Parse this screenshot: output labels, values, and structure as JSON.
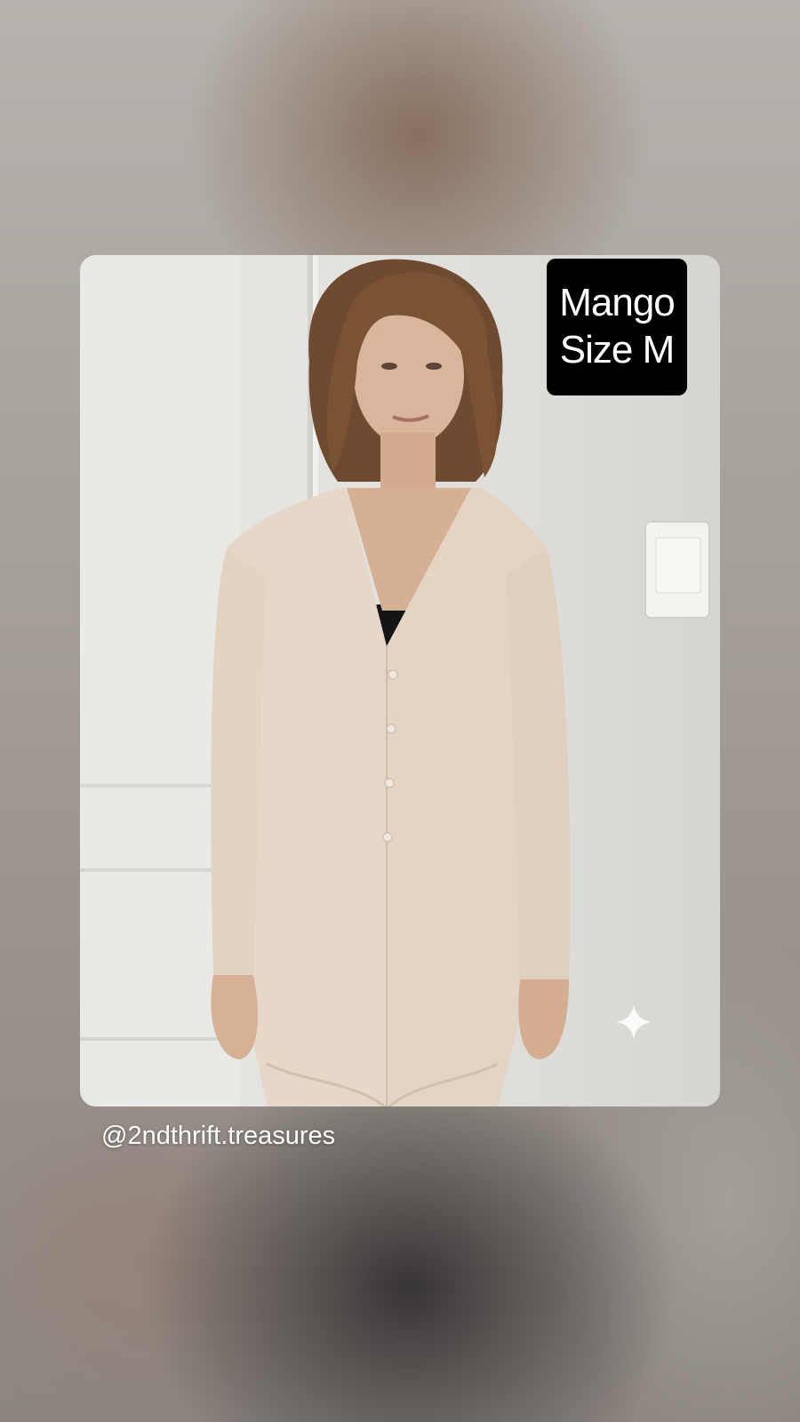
{
  "story": {
    "tag": {
      "line1": "Mango",
      "line2": "Size M"
    },
    "handle": "@2ndthrift.treasures",
    "sparkle_icon": "sparkle-icon"
  },
  "colors": {
    "tag_bg": "#000000",
    "tag_text": "#ffffff",
    "handle_text": "#ffffff"
  }
}
